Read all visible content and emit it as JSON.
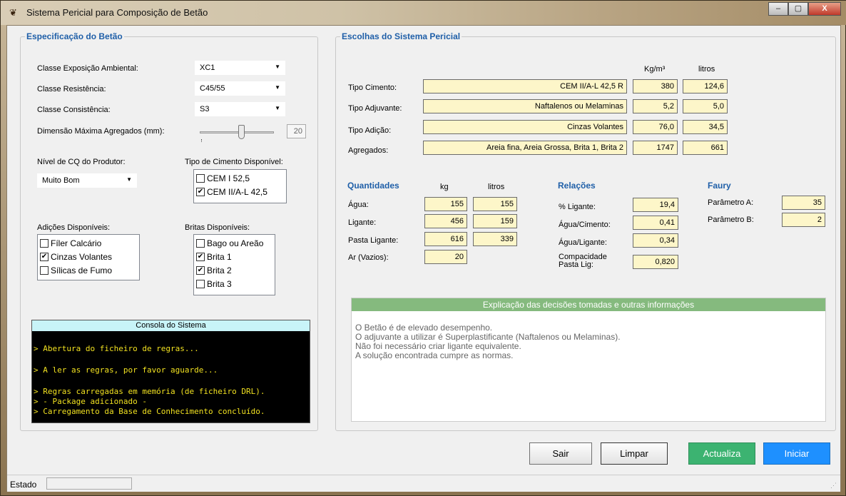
{
  "window": {
    "title": "Sistema Pericial para Composição de Betão",
    "buttons": {
      "min": "–",
      "max": "▢",
      "close": "X"
    }
  },
  "spec": {
    "legend": "Especificação do Betão",
    "exposicao_label": "Classe Exposição Ambiental:",
    "exposicao_value": "XC1",
    "resistencia_label": "Classe Resistência:",
    "resistencia_value": "C45/55",
    "consistencia_label": "Classe Consistência:",
    "consistencia_value": "S3",
    "dimensao_label": "Dimensão Máxima Agregados (mm):",
    "dimensao_value": "20",
    "slider_level": 0.5,
    "cq_label": "Nível de CQ do Produtor:",
    "cq_value": "Muito Bom",
    "cimento_label": "Tipo de Cimento Disponível:",
    "cimentos": [
      {
        "label": "CEM I 52,5",
        "checked": false
      },
      {
        "label": "CEM II/A-L 42,5",
        "checked": true
      }
    ],
    "adicoes_label": "Adições Disponíveis:",
    "adicoes": [
      {
        "label": "Fíler Calcário",
        "checked": false
      },
      {
        "label": "Cinzas Volantes",
        "checked": true
      },
      {
        "label": "Sílicas de Fumo",
        "checked": false
      }
    ],
    "britas_label": "Britas Disponíveis:",
    "britas": [
      {
        "label": "Bago ou Areão",
        "checked": false
      },
      {
        "label": "Brita 1",
        "checked": true
      },
      {
        "label": "Brita 2",
        "checked": true
      },
      {
        "label": "Brita 3",
        "checked": false
      }
    ]
  },
  "console": {
    "title": "Consola do Sistema",
    "lines": [
      "> Abertura do ficheiro de regras...",
      "> A ler as regras, por favor aguarde...",
      "> Regras carregadas em memória (de ficheiro DRL).",
      "> - Package adicionado -",
      "> Carregamento da Base de Conhecimento concluído."
    ]
  },
  "escolhas": {
    "legend": "Escolhas do Sistema Pericial",
    "col_kg": "Kg/m³",
    "col_litros": "litros",
    "rows": [
      {
        "label": "Tipo Cimento:",
        "value": "CEM II/A-L 42,5 R",
        "kg": "380",
        "litros": "124,6"
      },
      {
        "label": "Tipo Adjuvante:",
        "value": "Naftalenos ou Melaminas",
        "kg": "5,2",
        "litros": "5,0"
      },
      {
        "label": "Tipo Adição:",
        "value": "Cinzas Volantes",
        "kg": "76,0",
        "litros": "34,5"
      },
      {
        "label": "Agregados:",
        "value": "Areia fina, Areia Grossa, Brita 1, Brita 2",
        "kg": "1747",
        "litros": "661"
      }
    ]
  },
  "quantidades": {
    "title": "Quantidades",
    "col_kg": "kg",
    "col_litros": "litros",
    "rows": [
      {
        "label": "Água:",
        "kg": "155",
        "litros": "155"
      },
      {
        "label": "Ligante:",
        "kg": "456",
        "litros": "159"
      },
      {
        "label": "Pasta Ligante:",
        "kg": "616",
        "litros": "339"
      },
      {
        "label": "Ar (Vazios):",
        "kg": "20",
        "litros": ""
      }
    ]
  },
  "relacoes": {
    "title": "Relações",
    "rows": [
      {
        "label": "% Ligante:",
        "value": "19,4"
      },
      {
        "label": "Água/Cimento:",
        "value": "0,41"
      },
      {
        "label": "Água/Ligante:",
        "value": "0,34"
      },
      {
        "label": "Compacidade Pasta Lig:",
        "value": "0,820"
      }
    ]
  },
  "faury": {
    "title": "Faury",
    "param_a_label": "Parâmetro A:",
    "param_a_value": "35",
    "param_b_label": "Parâmetro B:",
    "param_b_value": "2"
  },
  "info": {
    "header": "Explicação das decisões tomadas e outras informações",
    "lines": [
      "O Betão é de elevado desempenho.",
      "O adjuvante a utilizar é Superplastificante (Naftalenos ou Melaminas).",
      "Não foi necessário criar ligante equivalente.",
      "A solução encontrada cumpre as normas."
    ]
  },
  "buttons": {
    "sair": "Sair",
    "limpar": "Limpar",
    "actualiza": "Actualiza",
    "iniciar": "Iniciar"
  },
  "colors": {
    "legend": "#1f5fa8",
    "field_bg": "#fdf6c9",
    "actualiza": "#3cb371",
    "iniciar": "#1e90ff",
    "console_text": "#f0e020"
  },
  "status": {
    "label": "Estado"
  }
}
